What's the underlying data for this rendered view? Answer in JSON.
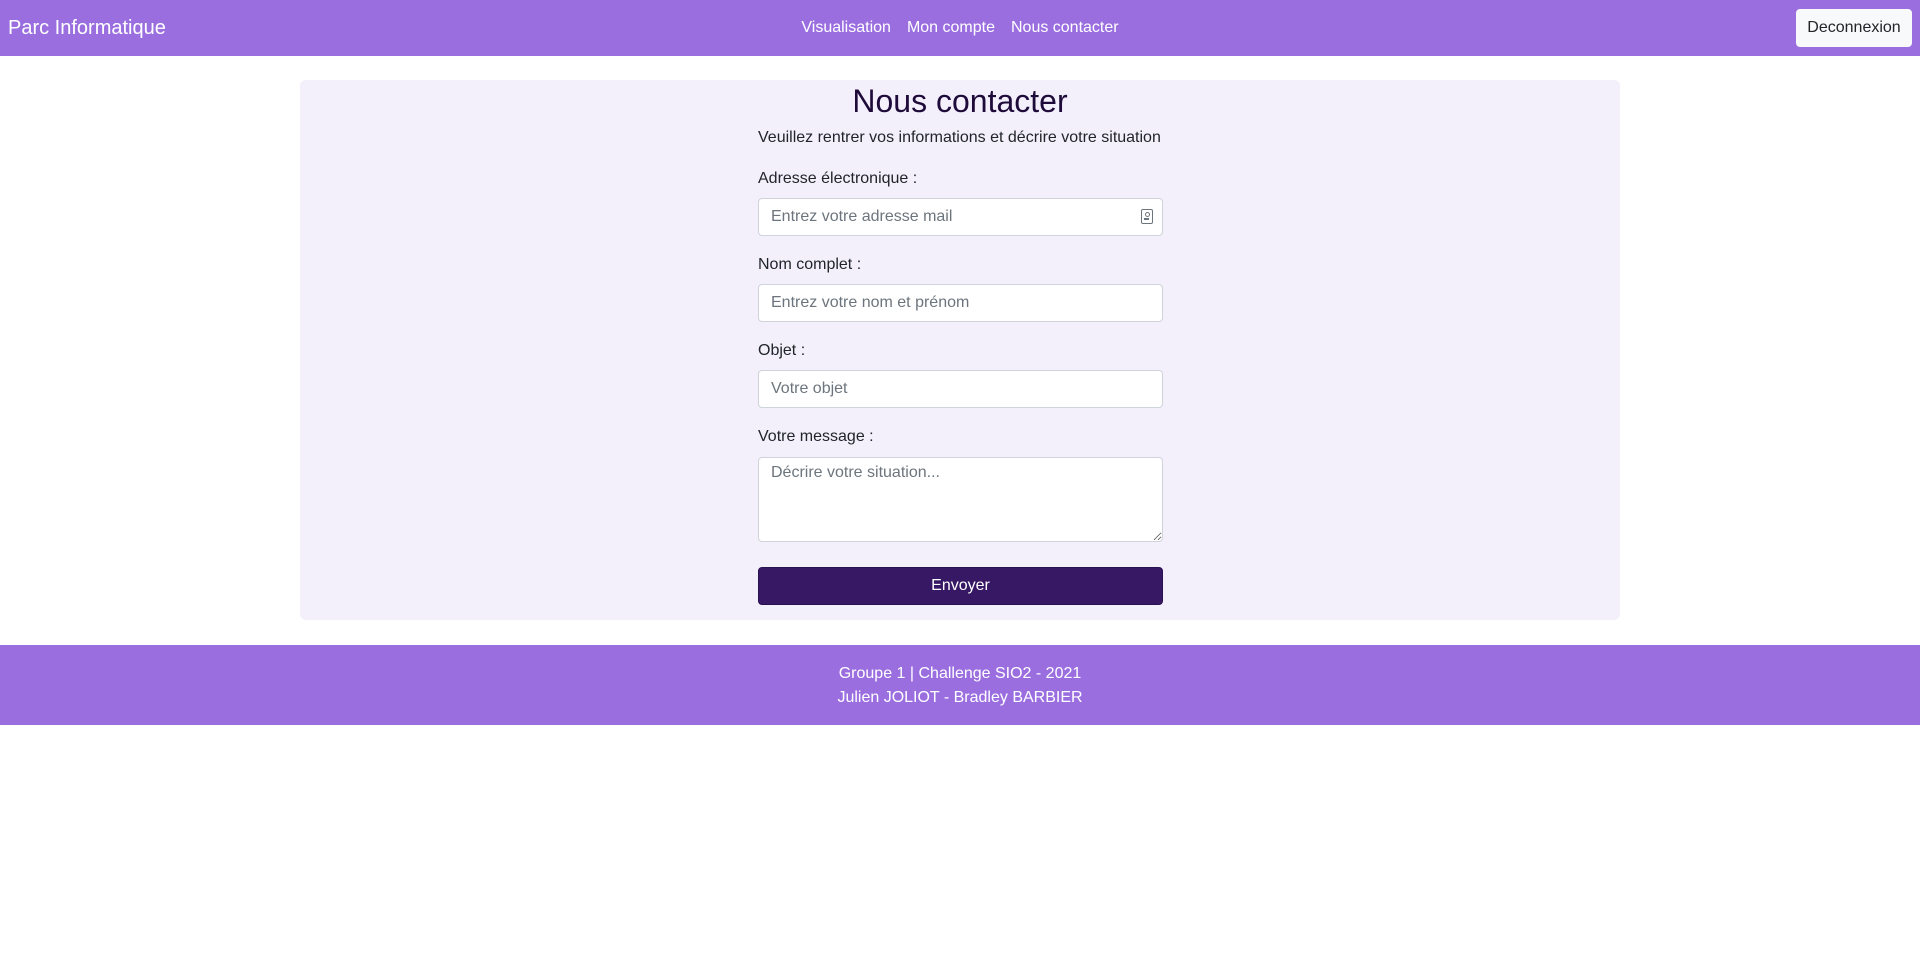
{
  "navbar": {
    "brand": "Parc Informatique",
    "links": [
      "Visualisation",
      "Mon compte",
      "Nous contacter"
    ],
    "logout_label": "Deconnexion"
  },
  "contact": {
    "title": "Nous contacter",
    "subtitle": "Veuillez rentrer vos informations et décrire votre situation",
    "email_label": "Adresse électronique :",
    "email_placeholder": "Entrez votre adresse mail",
    "name_label": "Nom complet :",
    "name_placeholder": "Entrez votre nom et prénom",
    "subject_label": "Objet :",
    "subject_placeholder": "Votre objet",
    "message_label": "Votre message :",
    "message_placeholder": "Décrire votre situation...",
    "send_label": "Envoyer"
  },
  "footer": {
    "line1": "Groupe 1 | Challenge SIO2 - 2021",
    "line2": "Julien JOLIOT - Bradley BARBIER"
  },
  "colors": {
    "navbar_bg": "#9b6ee0",
    "card_bg": "#f3f0fc",
    "button_bg": "#371865"
  }
}
